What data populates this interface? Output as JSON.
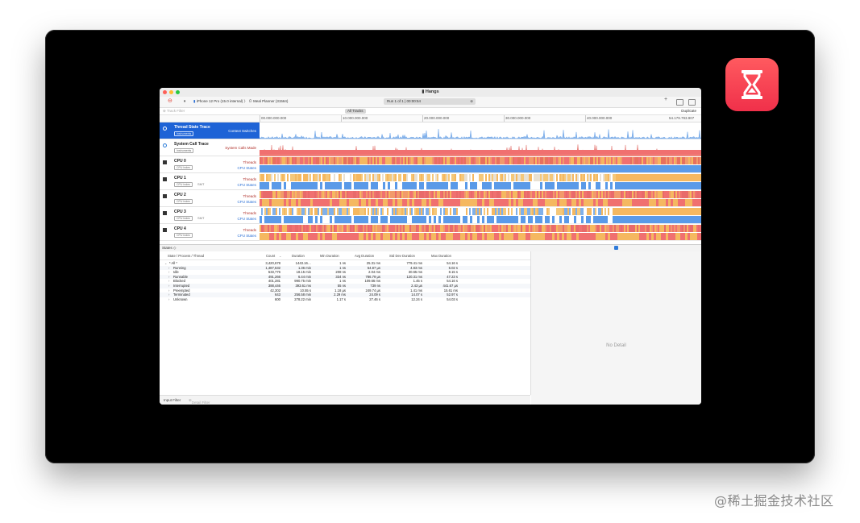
{
  "window": {
    "title": "Hangs",
    "toolbar": {
      "device": "iPhone 12 Pro (15.0 internal)",
      "separator": "〉",
      "process": "Meal Planner (31564)",
      "run": "Run 1 of 1",
      "divider": "|",
      "time": "00:00:54"
    },
    "filter_placeholder": "Track Filter",
    "all_tracks": "All Tracks",
    "duplicate": "Duplicate"
  },
  "ruler": {
    "ticks": [
      "00.000.000.000",
      "10.000.000.000",
      "20.000.000.000",
      "30.000.000.000",
      "40.000.000.000",
      "54.179.793.907"
    ]
  },
  "tracks": [
    {
      "name": "Thread State Trace",
      "sub": "Instruments",
      "right1": "Context Switches",
      "right2": "",
      "smt": "",
      "icon": "circle"
    },
    {
      "name": "System Call Trace",
      "sub": "Instruments",
      "right1": "System Calls Made",
      "right2": "",
      "smt": "",
      "icon": "circle"
    },
    {
      "name": "CPU 0",
      "sub": "CPU Index",
      "right1": "Threads",
      "right2": "CPU States",
      "smt": "",
      "icon": "square"
    },
    {
      "name": "CPU 1",
      "sub": "CPU Index",
      "right1": "Threads",
      "right2": "CPU States",
      "smt": "SMT",
      "icon": "square"
    },
    {
      "name": "CPU 2",
      "sub": "CPU Index",
      "right1": "Threads",
      "right2": "CPU States",
      "smt": "",
      "icon": "square"
    },
    {
      "name": "CPU 3",
      "sub": "CPU Index",
      "right1": "Threads",
      "right2": "CPU States",
      "smt": "SMT",
      "icon": "square"
    },
    {
      "name": "CPU 4",
      "sub": "CPU Index",
      "right1": "Threads",
      "right2": "CPU States",
      "smt": "",
      "icon": "square"
    }
  ],
  "bottom": {
    "panel_label": "States",
    "panel_arrow": "◇",
    "columns": [
      "State / Process / Thread",
      "Count",
      "Duration",
      "Min Duration",
      "Avg Duration",
      "Std Dev Duration",
      "Max Duration"
    ],
    "rows": [
      {
        "name": "* All *",
        "count": "3,420,678",
        "duration": "1443.16…",
        "min": "1 ns",
        "avg": "25.31 ms",
        "std": "779.41 ms",
        "max": "54.16 s"
      },
      {
        "name": "Running",
        "count": "1,487,532",
        "duration": "1.36 min",
        "min": "1 ns",
        "avg": "54.87 µs",
        "std": "4.83 ms",
        "max": "5.02 s"
      },
      {
        "name": "Idle",
        "count": "533,776",
        "duration": "18.15 min",
        "min": "208 ns",
        "avg": "2.04 ms",
        "std": "30.65 ms",
        "max": "8.15 s"
      },
      {
        "name": "Runnable",
        "count": "491,266",
        "duration": "6.44 min",
        "min": "334 ns",
        "avg": "786.79 µs",
        "std": "120.31 ms",
        "max": "47.23 s"
      },
      {
        "name": "Blocked",
        "count": "401,281",
        "duration": "990.75 min",
        "min": "1 ns",
        "avg": "109.66 ms",
        "std": "1.45 s",
        "max": "54.16 s"
      },
      {
        "name": "Interrupted",
        "count": "388,446",
        "duration": "393.61 ms",
        "min": "55 ns",
        "avg": "739 ns",
        "std": "2.43 µs",
        "max": "441.67 µs"
      },
      {
        "name": "Preempted",
        "count": "42,302",
        "duration": "10.55 s",
        "min": "1.18 µs",
        "avg": "249.74 µs",
        "std": "1.41 ms",
        "max": "15.61 ms"
      },
      {
        "name": "Terminated",
        "count": "643",
        "duration": "256.58 min",
        "min": "2.29 ms",
        "avg": "24.09 s",
        "std": "14.07 s",
        "max": "52.97 s"
      },
      {
        "name": "Unknown",
        "count": "600",
        "duration": "278.22 min",
        "min": "1.17 s",
        "avg": "27.46 s",
        "std": "12.24 s",
        "max": "54.03 s"
      }
    ],
    "no_detail": "No Detail",
    "input_filter": "Input Filter",
    "detail_filter": "Detail Filter"
  },
  "watermark": "@稀土掘金技术社区",
  "colors": {
    "selected_track": "#1e63d6",
    "thread_red": "#f07070",
    "state_orange": "#f5b860",
    "state_blue": "#5a9ae8",
    "app_icon": "#f0304a"
  }
}
